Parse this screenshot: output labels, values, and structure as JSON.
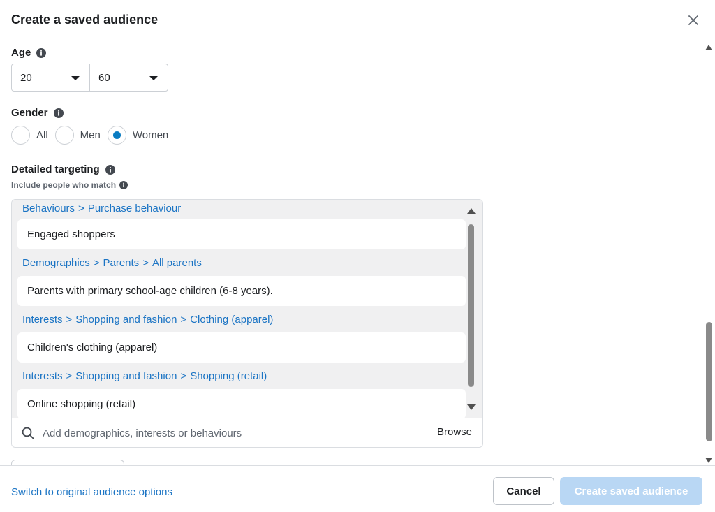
{
  "dialog": {
    "title": "Create a saved audience"
  },
  "age": {
    "label": "Age",
    "min": "20",
    "max": "60"
  },
  "gender": {
    "label": "Gender",
    "options": [
      {
        "label": "All",
        "checked": false
      },
      {
        "label": "Men",
        "checked": false
      },
      {
        "label": "Women",
        "checked": true
      }
    ]
  },
  "targeting": {
    "label": "Detailed targeting",
    "sublabel": "Include people who match",
    "groups": [
      {
        "path": [
          "Behaviours",
          "Purchase behaviour"
        ],
        "item": "Engaged shoppers"
      },
      {
        "path": [
          "Demographics",
          "Parents",
          "All parents"
        ],
        "item": "Parents with primary school-age children (6-8 years)."
      },
      {
        "path": [
          "Interests",
          "Shopping and fashion",
          "Clothing (apparel)"
        ],
        "item": "Children's clothing (apparel)"
      },
      {
        "path": [
          "Interests",
          "Shopping and fashion",
          "Shopping (retail)"
        ],
        "item": "Online shopping (retail)"
      }
    ],
    "search_placeholder": "Add demographics, interests or behaviours",
    "browse_label": "Browse"
  },
  "footer": {
    "switch_link": "Switch to original audience options",
    "cancel_label": "Cancel",
    "create_label": "Create saved audience"
  },
  "colors": {
    "link": "#1b74c4",
    "radio_selected": "#0a7cc2",
    "create_disabled": "#b9d7f4"
  },
  "icons": {
    "close": "close-icon",
    "info": "info-icon",
    "search": "search-icon",
    "caret": "caret-down-icon"
  }
}
